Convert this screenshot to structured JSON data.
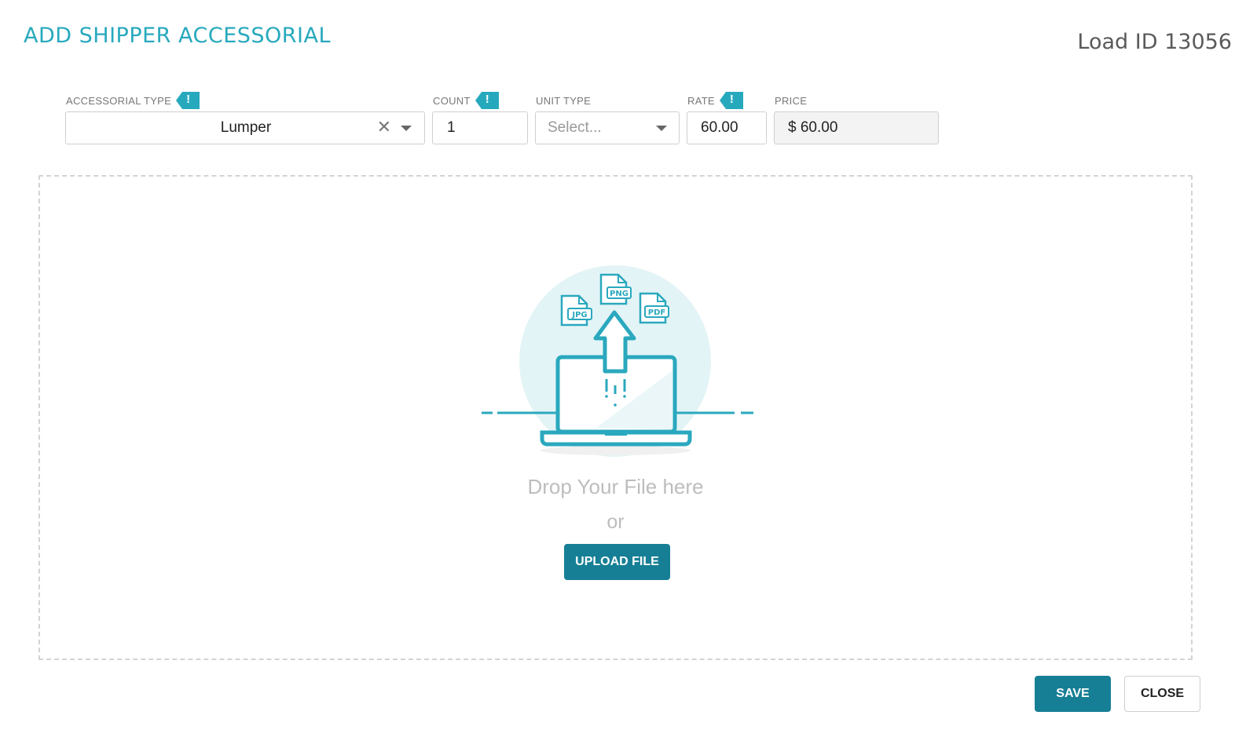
{
  "header": {
    "title": "ADD SHIPPER ACCESSORIAL",
    "load_id": "Load ID 13056"
  },
  "form": {
    "accessorial_type": {
      "label": "ACCESSORIAL TYPE",
      "value": "Lumper",
      "required": true
    },
    "count": {
      "label": "COUNT",
      "value": "1",
      "required": true
    },
    "unit_type": {
      "label": "UNIT TYPE",
      "placeholder": "Select...",
      "required": false
    },
    "rate": {
      "label": "RATE",
      "value": "60.00",
      "required": true
    },
    "price": {
      "label": "PRICE",
      "value": "$ 60.00",
      "required": false
    }
  },
  "dropzone": {
    "file_types": [
      "JPG",
      "PNG",
      "PDF"
    ],
    "drop_text": "Drop Your File here",
    "or_text": "or",
    "upload_label": "UPLOAD FILE"
  },
  "footer": {
    "save_label": "SAVE",
    "close_label": "CLOSE"
  },
  "colors": {
    "title": "#27a9bd",
    "accent": "#167f95",
    "illustration": "#2aa8be",
    "illustration_bg": "#e3f4f6"
  }
}
